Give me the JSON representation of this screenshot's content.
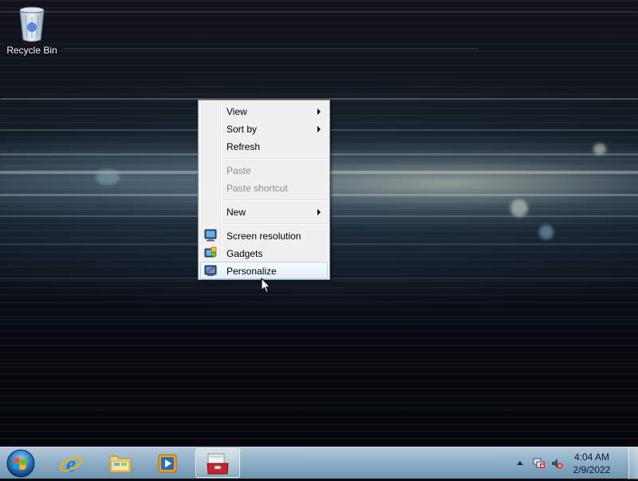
{
  "desktop": {
    "icons": [
      {
        "label": "Recycle Bin",
        "icon": "recycle-bin-icon"
      }
    ]
  },
  "context_menu": {
    "items": [
      {
        "label": "View",
        "has_submenu": true,
        "enabled": true
      },
      {
        "label": "Sort by",
        "has_submenu": true,
        "enabled": true
      },
      {
        "label": "Refresh",
        "has_submenu": false,
        "enabled": true
      },
      {
        "label": "Paste",
        "has_submenu": false,
        "enabled": false
      },
      {
        "label": "Paste shortcut",
        "has_submenu": false,
        "enabled": false
      },
      {
        "label": "New",
        "has_submenu": true,
        "enabled": true
      },
      {
        "label": "Screen resolution",
        "icon": "screen-resolution-icon",
        "enabled": true
      },
      {
        "label": "Gadgets",
        "icon": "gadgets-icon",
        "enabled": true
      },
      {
        "label": "Personalize",
        "icon": "personalize-icon",
        "enabled": true,
        "highlighted": true
      }
    ]
  },
  "taskbar": {
    "pinned": [
      {
        "name": "start-button",
        "icon": "windows-orb-icon"
      },
      {
        "name": "internet-explorer",
        "icon": "internet-explorer-icon"
      },
      {
        "name": "windows-explorer",
        "icon": "folder-icon"
      },
      {
        "name": "media-player",
        "icon": "media-player-icon"
      },
      {
        "name": "toolbox-app",
        "icon": "toolbox-icon",
        "active": true
      }
    ],
    "tray": {
      "icons": [
        "show-hidden-icons-arrow",
        "network-icon",
        "volume-muted-icon"
      ],
      "time": "4:04 AM",
      "date": "2/9/2022"
    }
  },
  "colors": {
    "menu_background": "#f0f0f0",
    "menu_hover": "#e3effc",
    "menu_hover_border": "#a8d8f8",
    "disabled_text": "#8d8d8d",
    "taskbar": "#8fb1c9"
  }
}
